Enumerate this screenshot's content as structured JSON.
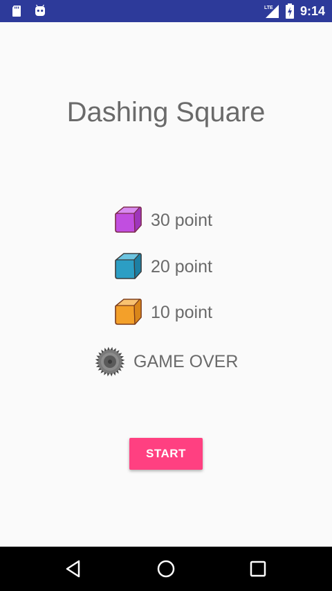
{
  "status_bar": {
    "time": "9:14",
    "network": "LTE",
    "bg_color": "#2d3a9a"
  },
  "app": {
    "title": "Dashing Square"
  },
  "legend": [
    {
      "icon": "purple-cube-icon",
      "color": "#c14ee0",
      "label": "30 point"
    },
    {
      "icon": "blue-cube-icon",
      "color": "#2c9ec4",
      "label": "20 point"
    },
    {
      "icon": "orange-cube-icon",
      "color": "#f3a02a",
      "label": "10 point"
    },
    {
      "icon": "saw-blade-icon",
      "color": "#666666",
      "label": "GAME OVER"
    }
  ],
  "start_button": {
    "label": "START",
    "color": "#ff4081"
  },
  "nav_bar": {
    "back": "back-icon",
    "home": "home-icon",
    "recents": "recents-icon"
  }
}
